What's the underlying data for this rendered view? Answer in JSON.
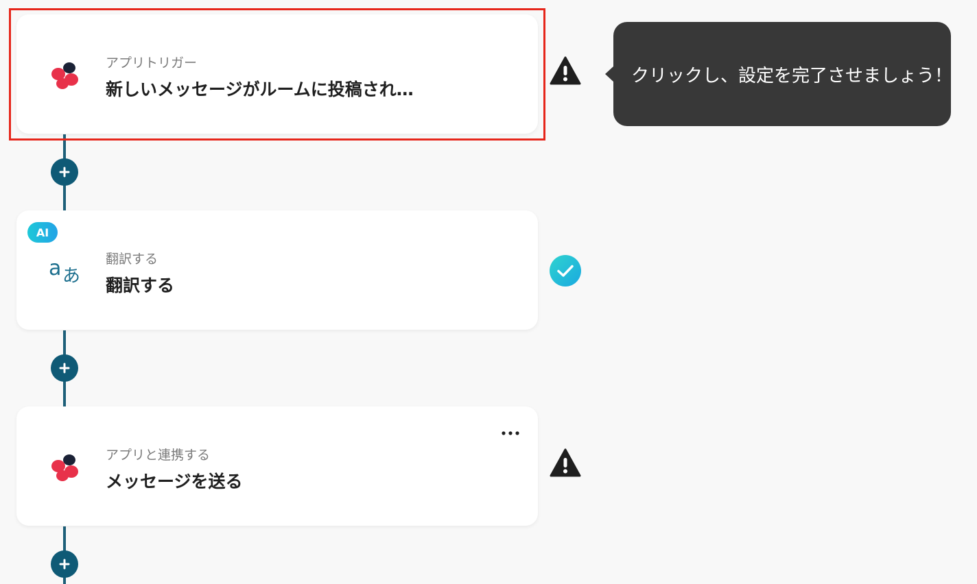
{
  "colors": {
    "connector": "#1d5f79",
    "add_button": "#0f5a76",
    "highlight_border": "#e6261b",
    "tooltip_bg": "#383838",
    "success": "#22bfd6",
    "warning": "#1f1f1f"
  },
  "steps": [
    {
      "icon": "chatwork-logo-icon",
      "subtitle": "アプリトリガー",
      "title": "新しいメッセージがルームに投稿され…",
      "status": "warning-icon",
      "highlighted": true
    },
    {
      "icon": "translate-icon",
      "badge": "AI",
      "subtitle": "翻訳する",
      "title": "翻訳する",
      "status": "check-icon"
    },
    {
      "icon": "chatwork-logo-icon",
      "subtitle": "アプリと連携する",
      "title": "メッセージを送る",
      "status": "warning-icon",
      "menu": "more-options-icon"
    }
  ],
  "tooltip": {
    "text": "クリックし、設定を完了させましょう！"
  }
}
